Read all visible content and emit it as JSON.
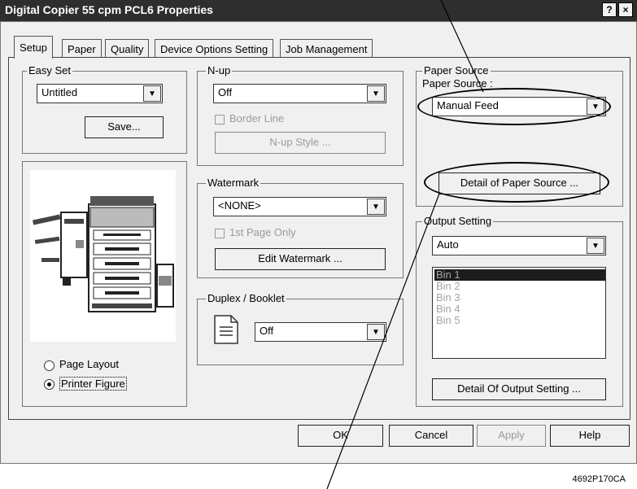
{
  "window": {
    "title": "Digital Copier 55 cpm PCL6 Properties",
    "help_label": "?",
    "close_label": "×"
  },
  "tabs": [
    "Setup",
    "Paper",
    "Quality",
    "Device Options Setting",
    "Job Management"
  ],
  "easy_set": {
    "label": "Easy Set",
    "value": "Untitled",
    "save_label": "Save..."
  },
  "nup": {
    "label": "N-up",
    "value": "Off",
    "border_line_label": "Border Line",
    "nup_style_label": "N-up Style ..."
  },
  "watermark": {
    "label": "Watermark",
    "value": "<NONE>",
    "first_page_only_label": "1st Page Only",
    "edit_label": "Edit Watermark ..."
  },
  "duplex": {
    "label": "Duplex / Booklet",
    "value": "Off"
  },
  "paper_source": {
    "group_label": "Paper Source",
    "field_label": "Paper Source :",
    "value": "Manual Feed",
    "detail_label": "Detail of Paper Source ..."
  },
  "output_setting": {
    "label": "Output Setting",
    "value": "Auto",
    "bins": [
      "Bin 1",
      "Bin 2",
      "Bin 3",
      "Bin 4",
      "Bin 5"
    ],
    "detail_label": "Detail Of Output Setting ..."
  },
  "view_options": {
    "page_layout_label": "Page Layout",
    "printer_figure_label": "Printer Figure",
    "selected": "Printer Figure"
  },
  "footer": {
    "ok_label": "OK",
    "cancel_label": "Cancel",
    "apply_label": "Apply",
    "help_label": "Help"
  },
  "figure_caption": "4692P170CA"
}
